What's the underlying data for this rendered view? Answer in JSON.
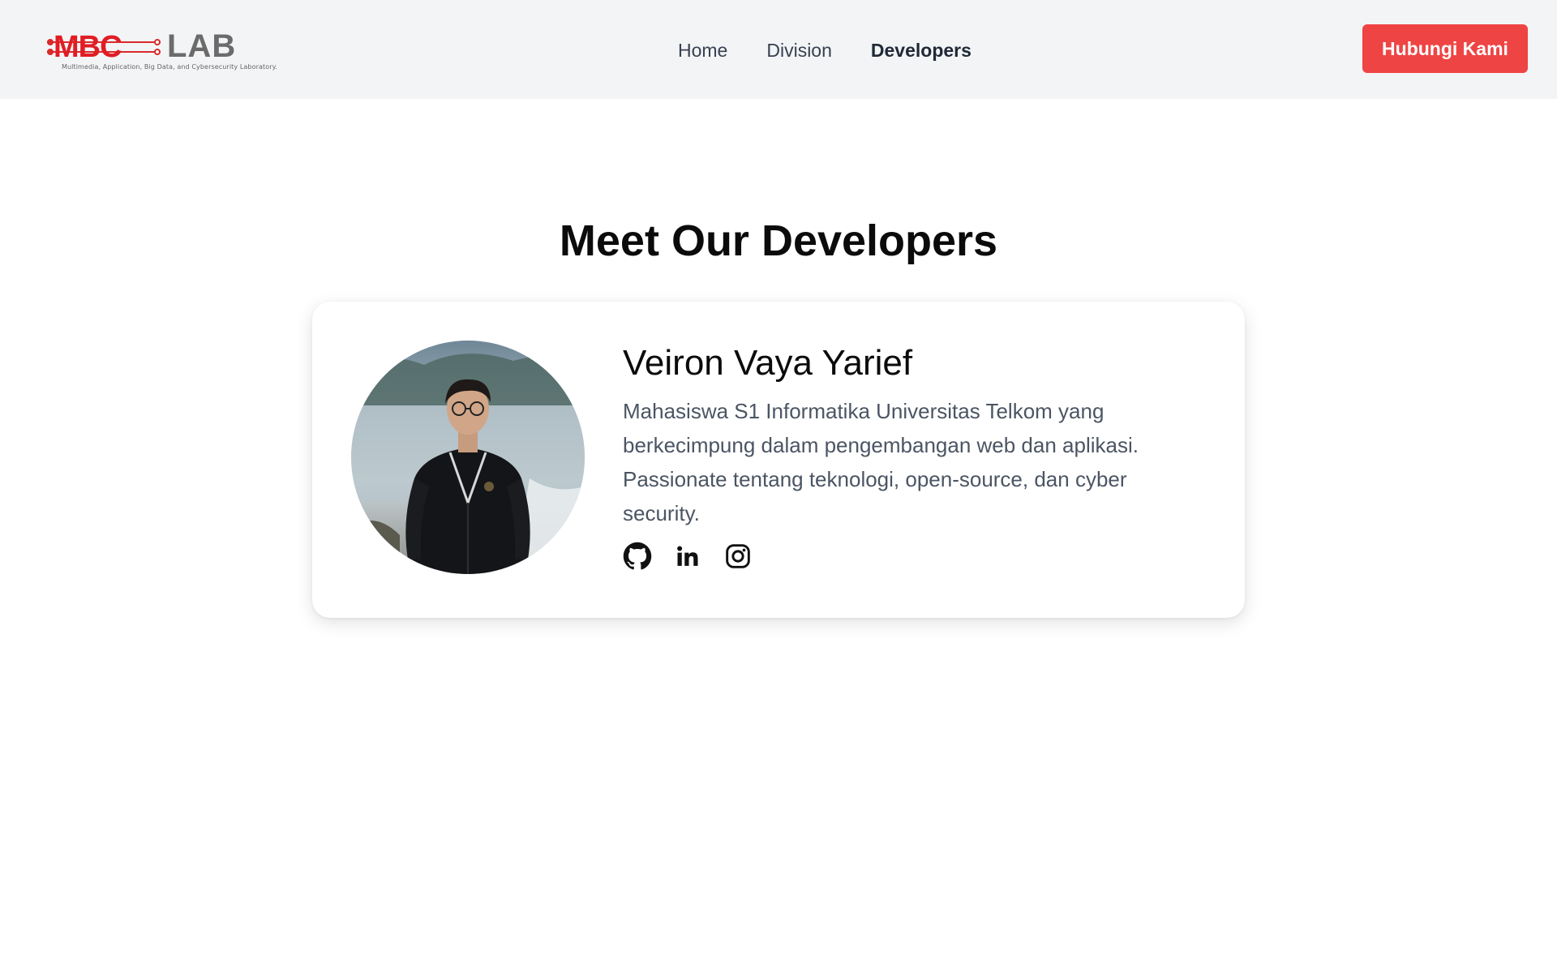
{
  "header": {
    "logo_text": "MBC LAB",
    "logo_tagline": "Multimedia, Application, Big Data, and Cybersecurity Laboratory.",
    "nav": [
      {
        "label": "Home",
        "active": false
      },
      {
        "label": "Division",
        "active": false
      },
      {
        "label": "Developers",
        "active": true
      }
    ],
    "cta_label": "Hubungi Kami"
  },
  "main": {
    "title": "Meet Our Developers",
    "developers": [
      {
        "name": "Veiron Vaya Yarief",
        "bio": "Mahasiswa S1 Informatika Universitas Telkom yang berkecimpung dalam pengembangan web dan aplikasi. Passionate tentang teknologi, open-source, dan cyber security.",
        "social": [
          "github-icon",
          "linkedin-icon",
          "instagram-icon"
        ]
      }
    ]
  },
  "colors": {
    "accent": "#ef4444",
    "header_bg": "#f3f4f6",
    "text_muted": "#4b5563"
  }
}
